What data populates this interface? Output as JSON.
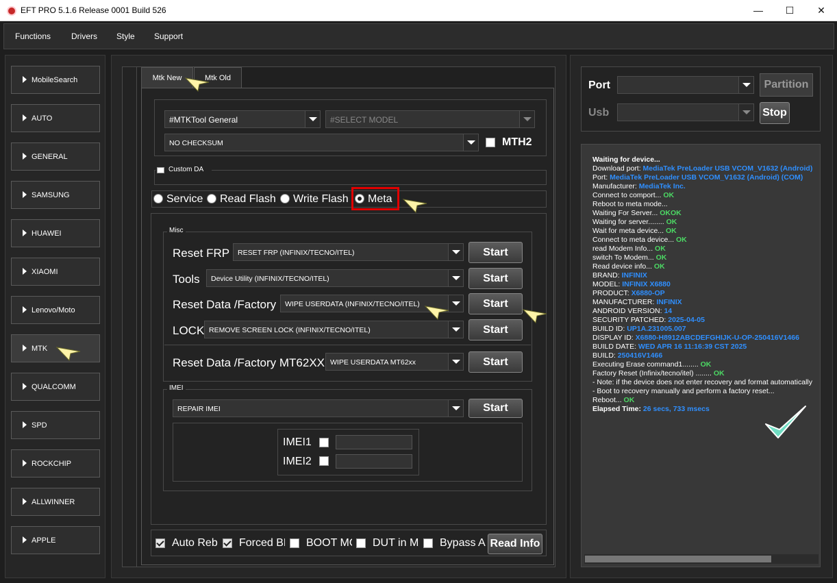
{
  "window": {
    "title": "EFT PRO 5.1.6 Release 0001 Build 526",
    "minimize": "—",
    "maximize": "☐",
    "close": "✕"
  },
  "menu": [
    "Functions",
    "Drivers",
    "Style",
    "Support"
  ],
  "sidebar": {
    "items": [
      "MobileSearch",
      "AUTO",
      "GENERAL",
      "SAMSUNG",
      "HUAWEI",
      "XIAOMI",
      "Lenovo/Moto",
      "MTK",
      "QUALCOMM",
      "SPD",
      "ROCKCHIP",
      "ALLWINNER",
      "APPLE"
    ],
    "active": "MTK"
  },
  "tabs": {
    "mtk_new": "Mtk New",
    "mtk_old": "Mtk Old"
  },
  "selectors": {
    "tool": "#MTKTool General",
    "model_placeholder": "#SELECT MODEL",
    "checksum": "NO CHECKSUM",
    "mth2": "MTH2",
    "custom_da": "Custom DA"
  },
  "modes": {
    "service": "Service",
    "read_flash": "Read Flash",
    "write_flash": "Write Flash",
    "meta": "Meta",
    "selected": "Meta"
  },
  "misc": {
    "title": "Misc",
    "rows": [
      {
        "label": "Reset FRP",
        "value": "RESET FRP (INFINIX/TECNO/ITEL)",
        "button": "Start"
      },
      {
        "label": "Tools",
        "value": "Device Utility (INFINIX/TECNO/ITEL)",
        "button": "Start"
      },
      {
        "label": "Reset Data /Factory",
        "value": "WIPE USERDATA (INFINIX/TECNO/ITEL)",
        "button": "Start"
      },
      {
        "label": "LOCK",
        "value": "REMOVE SCREEN LOCK (INFINIX/TECNO/ITEL)",
        "button": "Start"
      },
      {
        "label": "Reset Data /Factory MT62XX",
        "value": "WIPE USERDATA MT62xx",
        "button": "Start"
      }
    ]
  },
  "imei": {
    "title": "IMEI",
    "value": "REPAIR IMEI",
    "button": "Start",
    "imei1": "IMEI1",
    "imei2": "IMEI2"
  },
  "bottom": {
    "auto_reboot": "Auto Reboot",
    "forced_brom": "Forced BROM",
    "boot_mode": "BOOT MODE",
    "dut_in_meta": "DUT in META",
    "bypass_auth": "Bypass Auth",
    "read_info": "Read Info"
  },
  "port_panel": {
    "port": "Port",
    "usb": "Usb",
    "partition": "Partition",
    "stop": "Stop"
  },
  "log": [
    {
      "t": "Waiting for device...",
      "bold": true
    },
    {
      "t": "Download port: ",
      "v": "MediaTek PreLoader USB VCOM_V1632 (Android)",
      "c": "blue"
    },
    {
      "t": "Port: ",
      "v": "MediaTek PreLoader USB VCOM_V1632 (Android) (COM)",
      "c": "blue"
    },
    {
      "t": "Manufacturer: ",
      "v": "MediaTek Inc.",
      "c": "blue"
    },
    {
      "t": "Connect to comport... ",
      "v": "OK",
      "c": "ok"
    },
    {
      "t": "Reboot to meta mode..."
    },
    {
      "t": "Waiting For Server... ",
      "v": "OKOK",
      "c": "ok"
    },
    {
      "t": "Waiting for server........ ",
      "v": "OK",
      "c": "ok"
    },
    {
      "t": "Wait for meta device... ",
      "v": "OK",
      "c": "ok"
    },
    {
      "t": "Connect to meta device... ",
      "v": "OK",
      "c": "ok"
    },
    {
      "t": "read Modem Info... ",
      "v": "OK",
      "c": "ok"
    },
    {
      "t": "switch To Modem... ",
      "v": "OK",
      "c": "ok"
    },
    {
      "t": "Read device info... ",
      "v": "OK",
      "c": "ok"
    },
    {
      "t": " BRAND: ",
      "v": "INFINIX",
      "c": "blue"
    },
    {
      "t": " MODEL: ",
      "v": "INFINIX X6880",
      "c": "blue"
    },
    {
      "t": " PRODUCT: ",
      "v": "X6880-OP",
      "c": "blue"
    },
    {
      "t": " MANUFACTURER: ",
      "v": "INFINIX",
      "c": "blue"
    },
    {
      "t": " ANDROID VERSION: ",
      "v": "14",
      "c": "blue"
    },
    {
      "t": " SECURITY PATCHED: ",
      "v": "2025-04-05",
      "c": "blue"
    },
    {
      "t": " BUILD ID: ",
      "v": "UP1A.231005.007",
      "c": "blue"
    },
    {
      "t": " DISPLAY ID: ",
      "v": "X6880-H8912ABCDEFGHIJK-U-OP-250416V1466",
      "c": "blue"
    },
    {
      "t": " BUILD DATE: ",
      "v": "WED APR 16 11:16:39 CST 2025",
      "c": "blue"
    },
    {
      "t": " BUILD: ",
      "v": "250416V1466",
      "c": "blue"
    },
    {
      "t": "Executing Erase command1........ ",
      "v": "OK",
      "c": "ok"
    },
    {
      "t": "Factory Reset (Infinix/tecno/itel) ........ ",
      "v": "OK",
      "c": "ok"
    },
    {
      "t": " - Note: if the device does not enter recovery and format automatically"
    },
    {
      "t": " - Boot to recovery manually and perform a factory reset..."
    },
    {
      "t": "Reboot... ",
      "v": "OK",
      "c": "ok"
    },
    {
      "t": "Elapsed Time: ",
      "v": "26 secs, 733 msecs",
      "c": "blue",
      "bold": true
    }
  ]
}
